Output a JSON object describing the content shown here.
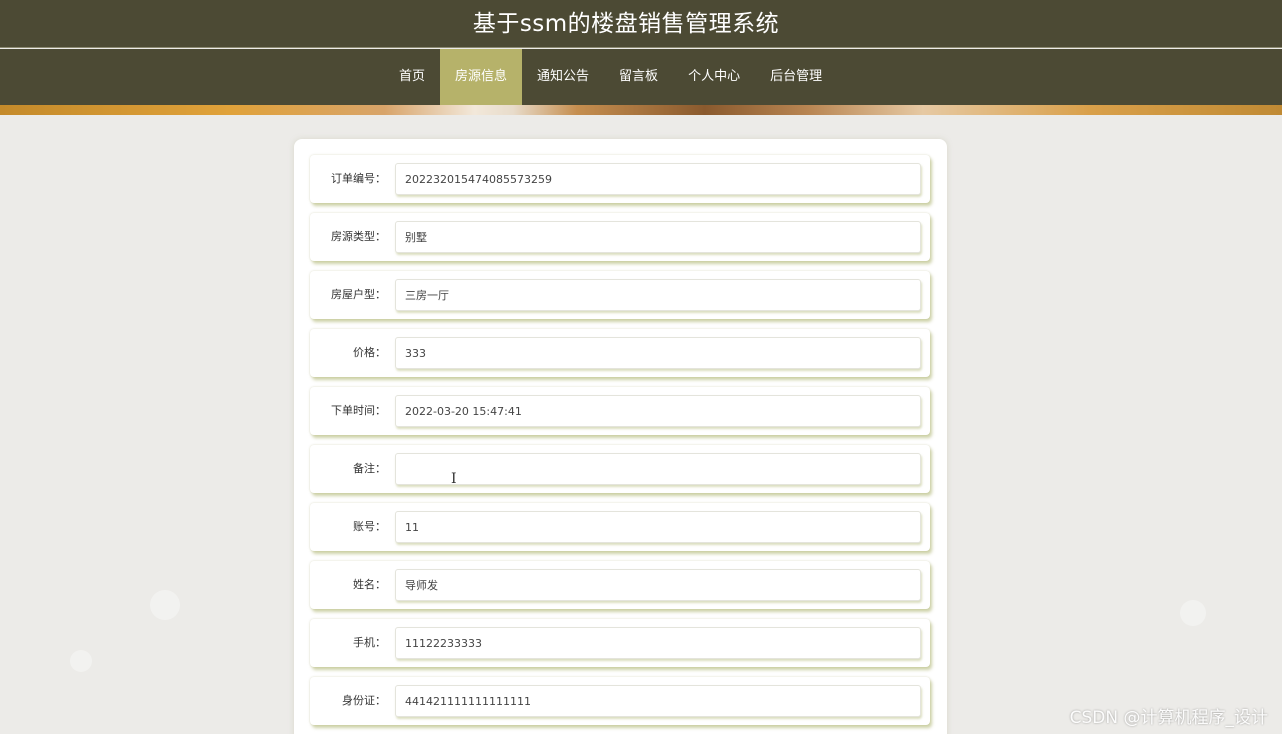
{
  "header": {
    "title": "基于ssm的楼盘销售管理系统"
  },
  "nav": {
    "items": [
      {
        "label": "首页"
      },
      {
        "label": "房源信息"
      },
      {
        "label": "通知公告"
      },
      {
        "label": "留言板"
      },
      {
        "label": "个人中心"
      },
      {
        "label": "后台管理"
      }
    ],
    "active_index": 1
  },
  "form": {
    "fields": [
      {
        "label": "订单编号：",
        "value": "202232015474085573259"
      },
      {
        "label": "房源类型：",
        "value": "别墅"
      },
      {
        "label": "房屋户型：",
        "value": "三房一厅"
      },
      {
        "label": "价格：",
        "value": "333"
      },
      {
        "label": "下单时间：",
        "value": "2022-03-20 15:47:41"
      },
      {
        "label": "备注：",
        "value": ""
      },
      {
        "label": "账号：",
        "value": "11"
      },
      {
        "label": "姓名：",
        "value": "导师发"
      },
      {
        "label": "手机：",
        "value": "11122233333"
      },
      {
        "label": "身份证：",
        "value": "441421111111111111"
      }
    ]
  },
  "watermark": "CSDN @计算机程序_设计",
  "colors": {
    "header_bg": "#4c4a34",
    "nav_active": "#b6b26a",
    "page_bg": "#ecebe8",
    "field_shadow": "#bec38c"
  }
}
